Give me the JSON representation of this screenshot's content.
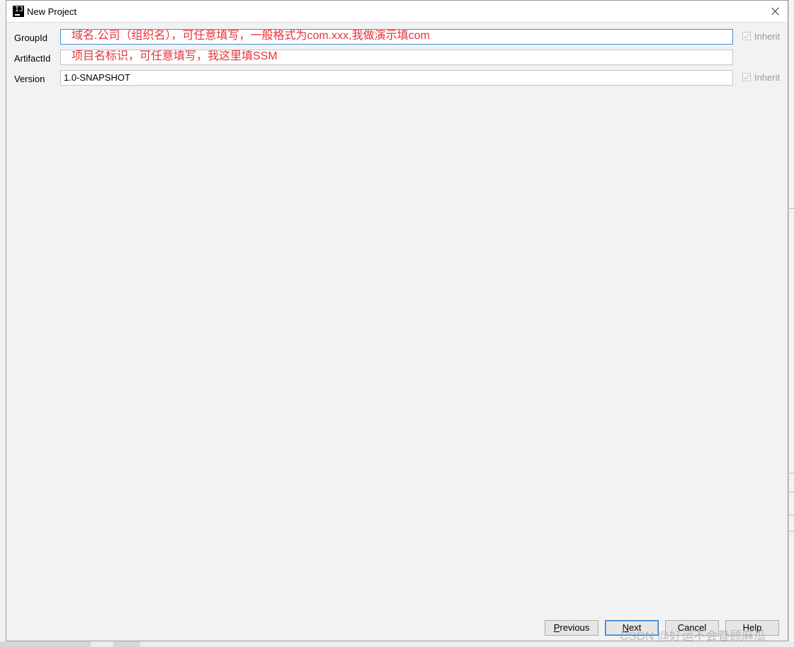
{
  "window": {
    "title": "New Project",
    "icon": "intellij-icon",
    "icon_glyph": "IJ"
  },
  "form": {
    "groupid": {
      "label": "GroupId",
      "value": "域名.公司（组织名），可任意填写，一般格式为com.xxx,我做演示填com",
      "inherit_label": "Inherit",
      "inherit_checked": true
    },
    "artifactid": {
      "label": "ArtifactId",
      "value": "项目名标识，可任意填写，我这里填SSM"
    },
    "version": {
      "label": "Version",
      "value": "1.0-SNAPSHOT",
      "inherit_label": "Inherit",
      "inherit_checked": true
    }
  },
  "buttons": {
    "previous": {
      "mnemonic": "P",
      "rest": "revious"
    },
    "next": {
      "mnemonic": "N",
      "rest": "ext"
    },
    "cancel": {
      "label": "Cancel"
    },
    "help": {
      "label": "Help"
    }
  },
  "watermark": "CSDN @好运不会眷顾麻瓜",
  "colors": {
    "annotation_text": "#e8333a",
    "focus_border": "#3d8fd6",
    "dialog_bg": "#f2f2f2"
  }
}
